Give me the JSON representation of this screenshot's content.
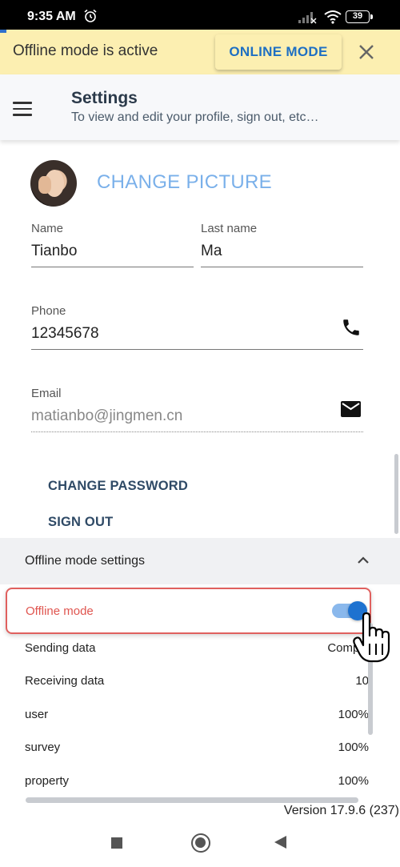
{
  "status_bar": {
    "time": "9:35 AM",
    "battery": "39",
    "icons": [
      "alarm-icon",
      "signal-icon",
      "wifi-icon",
      "battery-icon"
    ]
  },
  "banner": {
    "text": "Offline mode is active",
    "online_button": "ONLINE MODE",
    "bg_color": "#fcefb1",
    "accent_color": "#1e6fc3"
  },
  "header": {
    "title": "Settings",
    "subtitle": "To view and edit your profile, sign out, etc…"
  },
  "profile": {
    "change_picture": "CHANGE PICTURE",
    "name_label": "Name",
    "name_value": "Tianbo",
    "last_name_label": "Last name",
    "last_name_value": "Ma",
    "phone_label": "Phone",
    "phone_value": "12345678",
    "email_label": "Email",
    "email_value": "matianbo@jingmen.cn"
  },
  "actions": {
    "change_password": "CHANGE PASSWORD",
    "sign_out": "SIGN OUT"
  },
  "offline_settings": {
    "section_title": "Offline mode settings",
    "offline_mode_label": "Offline mode",
    "offline_mode_on": true,
    "rows": [
      {
        "name": "Sending data",
        "value": "Comple"
      },
      {
        "name": "Receiving data",
        "value": "10"
      },
      {
        "name": "user",
        "value": "100%"
      },
      {
        "name": "survey",
        "value": "100%"
      },
      {
        "name": "property",
        "value": "100%"
      }
    ]
  },
  "version": "Version 17.9.6 (237)",
  "colors": {
    "highlight_border": "#e0605e",
    "toggle_on": "#1e72d0",
    "link": "#7ab0ea"
  }
}
